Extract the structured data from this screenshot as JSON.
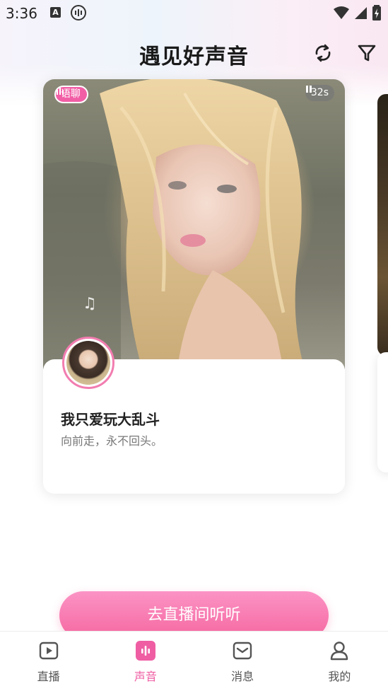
{
  "status_bar": {
    "time": "3:36",
    "indicator_letter": "A"
  },
  "header": {
    "title": "遇见好声音",
    "icons": [
      "refresh-icon",
      "filter-icon"
    ]
  },
  "card": {
    "badge_label": "语聊",
    "duration": "32s",
    "name": "我只爱玩大乱斗",
    "bio": "向前走，永不回头。"
  },
  "cta": {
    "label": "去直播间听听"
  },
  "bottom_nav": {
    "items": [
      {
        "label": "直播",
        "icon": "play-icon"
      },
      {
        "label": "声音",
        "icon": "voice-icon"
      },
      {
        "label": "消息",
        "icon": "message-icon"
      },
      {
        "label": "我的",
        "icon": "profile-icon"
      }
    ],
    "active_index": 1
  },
  "colors": {
    "accent": "#f25ea6",
    "active_tab": "#ef5ea3",
    "text_primary": "#222222",
    "text_secondary": "#777777"
  }
}
